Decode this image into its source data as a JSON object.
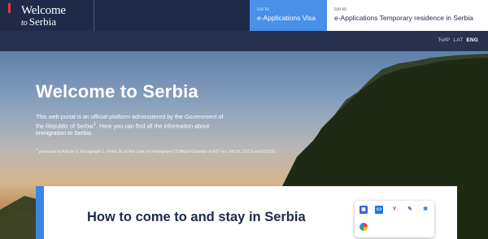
{
  "header": {
    "logo": {
      "top": "Welcome",
      "bottom_italic": "to",
      "bottom": "Serbia"
    },
    "tabs": [
      {
        "small": "Go to",
        "label": "e-Applications Visa"
      },
      {
        "small": "Go to",
        "label": "e-Applications Temporary residence in Serbia"
      }
    ],
    "languages": [
      {
        "label": "ЋИР",
        "active": false
      },
      {
        "label": "LAT",
        "active": false
      },
      {
        "label": "ENG",
        "active": true
      }
    ]
  },
  "hero": {
    "title": "Welcome to Serbia",
    "text_before_sup": "This web portal is an official platform administered by the Government of the Republic of Serbia",
    "sup": "1",
    "text_after_sup": ". Here you can find all the information about immigration to Serbia.",
    "note_sup": "1",
    "note": "pursuant to Article 3, Paragraph 1, Point 3c of the Law on Foreigners (\"Official Gazette of RS\" no. 24/18, 31/19 and 62/23)"
  },
  "card": {
    "title": "How to come to and stay in Serbia"
  },
  "extensions": {
    "icons": [
      "extension-icon",
      "screen-icon",
      "y-icon",
      "pen-icon",
      "bluetooth-icon",
      "google-icon"
    ],
    "glyphs": [
      "▣",
      "▭",
      "Y",
      "✎",
      "✱",
      ""
    ]
  },
  "colors": {
    "navy": "#1f2a48",
    "accent_blue": "#3a86e6",
    "logo_red": "#e03a3e"
  }
}
